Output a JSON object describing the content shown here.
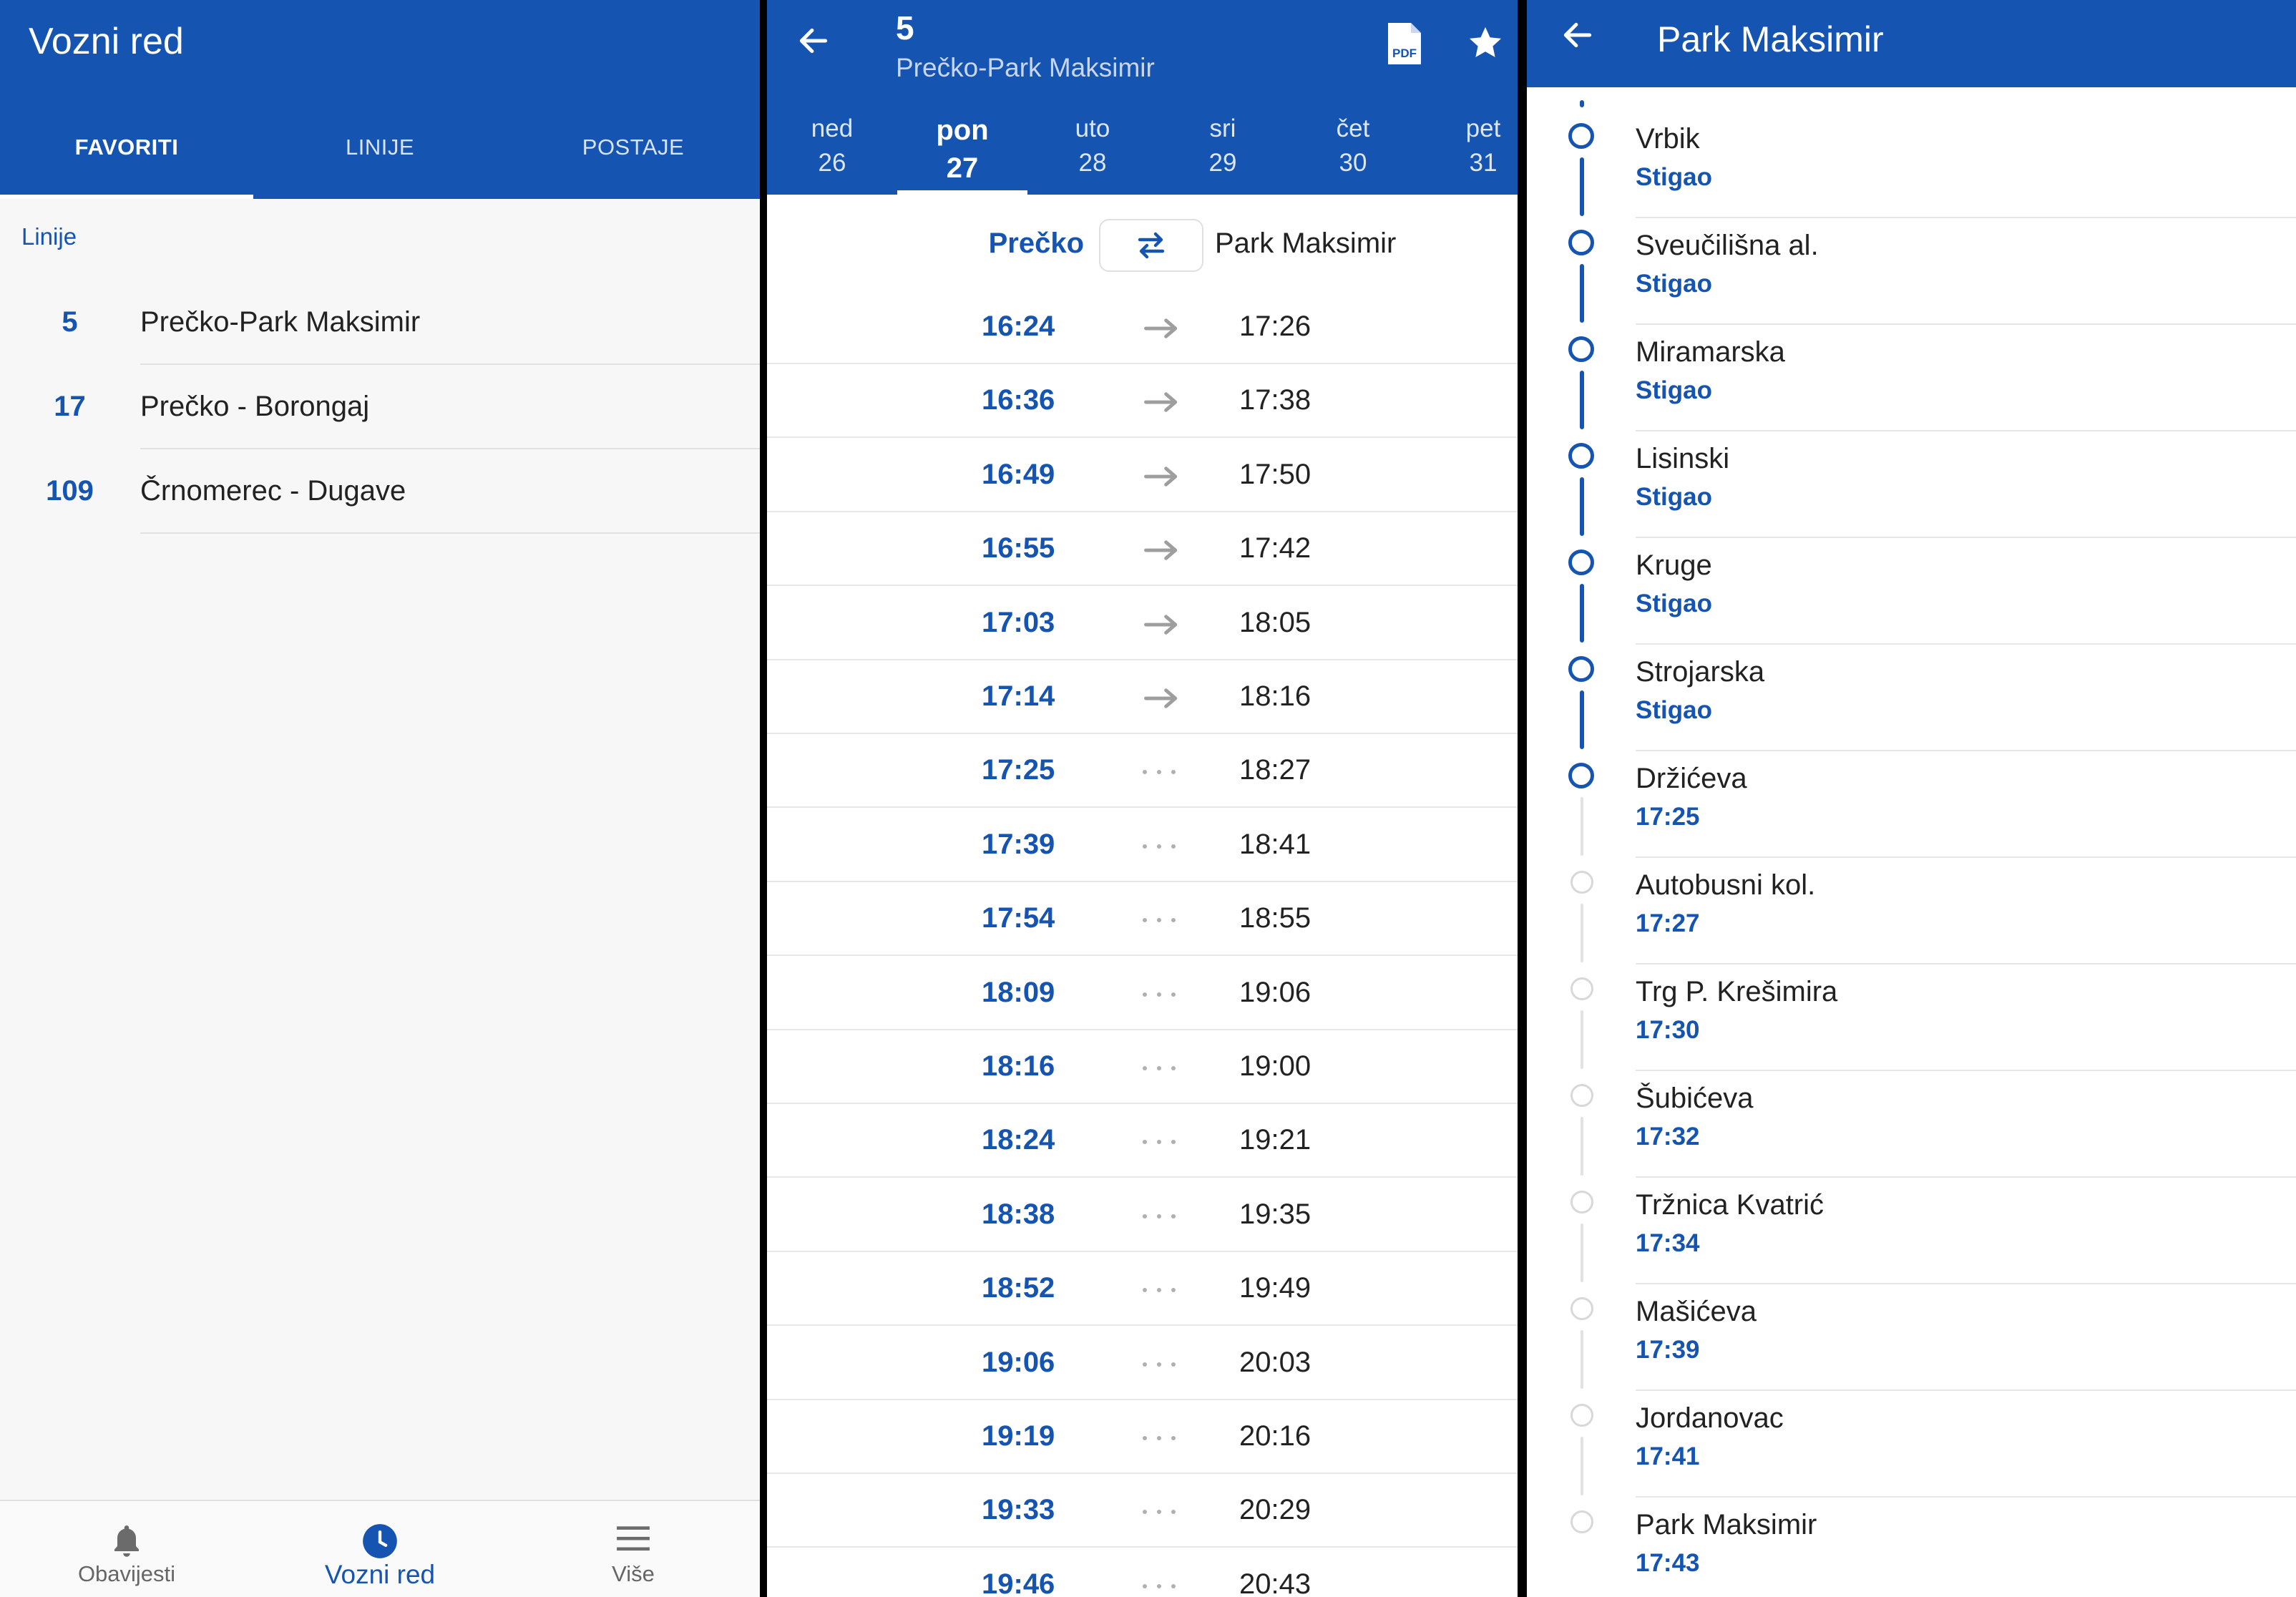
{
  "favorites_panel": {
    "title": "Vozni red",
    "tabs": [
      "FAVORITI",
      "LINIJE",
      "POSTAJE"
    ],
    "section_title": "Linije",
    "lines": [
      {
        "number": "5",
        "name": "Prečko-Park Maksimir"
      },
      {
        "number": "17",
        "name": "Prečko - Borongaj"
      },
      {
        "number": "109",
        "name": "Črnomerec - Dugave"
      }
    ],
    "bottom_nav": [
      {
        "label": "Obavijesti",
        "icon": "bell-icon"
      },
      {
        "label": "Vozni red",
        "icon": "clock-icon",
        "active": true
      },
      {
        "label": "Više",
        "icon": "menu-icon"
      }
    ]
  },
  "timetable_panel": {
    "line_number": "5",
    "line_name": "Prečko-Park Maksimir",
    "days": [
      {
        "name": "ned",
        "date": "26"
      },
      {
        "name": "pon",
        "date": "27",
        "active": true
      },
      {
        "name": "uto",
        "date": "28"
      },
      {
        "name": "sri",
        "date": "29"
      },
      {
        "name": "čet",
        "date": "30"
      },
      {
        "name": "pet",
        "date": "31"
      }
    ],
    "from": "Prečko",
    "to": "Park Maksimir",
    "departures": [
      {
        "dep": "16:24",
        "arr": "17:26",
        "status": "arrow"
      },
      {
        "dep": "16:36",
        "arr": "17:38",
        "status": "arrow"
      },
      {
        "dep": "16:49",
        "arr": "17:50",
        "status": "arrow"
      },
      {
        "dep": "16:55",
        "arr": "17:42",
        "status": "arrow"
      },
      {
        "dep": "17:03",
        "arr": "18:05",
        "status": "arrow"
      },
      {
        "dep": "17:14",
        "arr": "18:16",
        "status": "arrow"
      },
      {
        "dep": "17:25",
        "arr": "18:27",
        "status": "dots"
      },
      {
        "dep": "17:39",
        "arr": "18:41",
        "status": "dots"
      },
      {
        "dep": "17:54",
        "arr": "18:55",
        "status": "dots"
      },
      {
        "dep": "18:09",
        "arr": "19:06",
        "status": "dots"
      },
      {
        "dep": "18:16",
        "arr": "19:00",
        "status": "dots"
      },
      {
        "dep": "18:24",
        "arr": "19:21",
        "status": "dots"
      },
      {
        "dep": "18:38",
        "arr": "19:35",
        "status": "dots"
      },
      {
        "dep": "18:52",
        "arr": "19:49",
        "status": "dots"
      },
      {
        "dep": "19:06",
        "arr": "20:03",
        "status": "dots"
      },
      {
        "dep": "19:19",
        "arr": "20:16",
        "status": "dots"
      },
      {
        "dep": "19:33",
        "arr": "20:29",
        "status": "dots"
      },
      {
        "dep": "19:46",
        "arr": "20:43",
        "status": "dots"
      }
    ],
    "colors": {
      "primary": "#1554b0",
      "arrow": "#9e9e9e"
    }
  },
  "stops_panel": {
    "title": "Park Maksimir",
    "stops": [
      {
        "name": "Vrbik",
        "status": "Stigao",
        "passed": true
      },
      {
        "name": "Sveučilišna al.",
        "status": "Stigao",
        "passed": true
      },
      {
        "name": "Miramarska",
        "status": "Stigao",
        "passed": true
      },
      {
        "name": "Lisinski",
        "status": "Stigao",
        "passed": true
      },
      {
        "name": "Kruge ",
        "status": "Stigao",
        "passed": true
      },
      {
        "name": "Strojarska",
        "status": "Stigao",
        "passed": true
      },
      {
        "name": "Držićeva",
        "status": "17:25",
        "passed": true
      },
      {
        "name": "Autobusni kol.",
        "status": "17:27",
        "passed": false
      },
      {
        "name": "Trg P. Krešimira",
        "status": "17:30",
        "passed": false
      },
      {
        "name": "Šubićeva",
        "status": "17:32",
        "passed": false
      },
      {
        "name": "Tržnica Kvatrić",
        "status": "17:34",
        "passed": false
      },
      {
        "name": "Mašićeva",
        "status": "17:39",
        "passed": false
      },
      {
        "name": "Jordanovac",
        "status": "17:41",
        "passed": false
      },
      {
        "name": "Park Maksimir",
        "status": "17:43",
        "passed": false
      }
    ]
  }
}
